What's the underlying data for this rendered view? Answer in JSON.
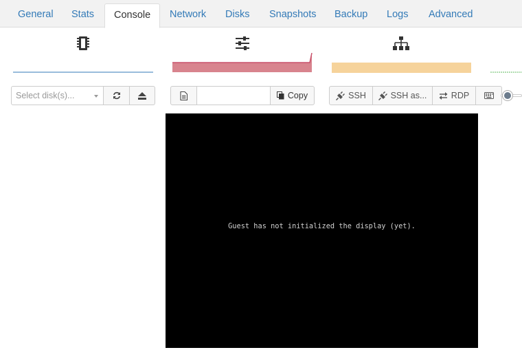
{
  "tabs": [
    {
      "label": "General",
      "active": false
    },
    {
      "label": "Stats",
      "active": false
    },
    {
      "label": "Console",
      "active": true
    },
    {
      "label": "Network",
      "active": false
    },
    {
      "label": "Disks",
      "active": false
    },
    {
      "label": "Snapshots",
      "active": false
    },
    {
      "label": "Backup",
      "active": false
    },
    {
      "label": "Logs",
      "active": false
    },
    {
      "label": "Advanced",
      "active": false
    }
  ],
  "metrics": {
    "cpu": {
      "icon": "cpu-chip-icon",
      "color": "#337ab7"
    },
    "memory": {
      "icon": "sliders-icon",
      "color": "#d9534f"
    },
    "network": {
      "icon": "sitemap-icon",
      "color": "#f0ad4e"
    },
    "disk": {
      "color": "#5cb85c"
    }
  },
  "toolbar": {
    "disk_select_placeholder": "Select disk(s)...",
    "refresh_icon": "refresh-icon",
    "eject_icon": "eject-icon",
    "clipboard_icon": "clipboard-icon",
    "clipboard_value": "",
    "copy_label": "Copy",
    "ssh_label": "SSH",
    "ssh_as_label": "SSH as...",
    "rdp_label": "RDP",
    "keyboard_icon": "keyboard-icon",
    "scale_slider_icon": "scale-slider-icon"
  },
  "console": {
    "message": "Guest has not initialized the display (yet)."
  }
}
